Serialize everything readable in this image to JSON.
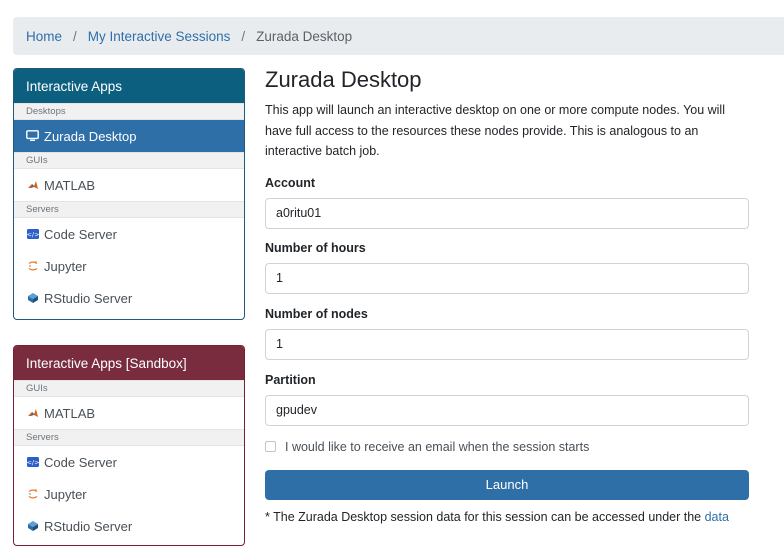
{
  "breadcrumb": {
    "home": "Home",
    "sessions": "My Interactive Sessions",
    "current": "Zurada Desktop",
    "separator": "/"
  },
  "sidebar_main": {
    "title": "Interactive Apps",
    "groups": {
      "desktops": "Desktops",
      "guis": "GUIs",
      "servers": "Servers"
    },
    "items": {
      "zurada_desktop": "Zurada Desktop",
      "matlab": "MATLAB",
      "code_server": "Code Server",
      "jupyter": "Jupyter",
      "rstudio": "RStudio Server"
    }
  },
  "sidebar_sandbox": {
    "title": "Interactive Apps [Sandbox]",
    "groups": {
      "guis": "GUIs",
      "servers": "Servers"
    },
    "items": {
      "matlab": "MATLAB",
      "code_server": "Code Server",
      "jupyter": "Jupyter",
      "rstudio": "RStudio Server"
    }
  },
  "form": {
    "title": "Zurada Desktop",
    "description": "This app will launch an interactive desktop on one or more compute nodes. You will have full access to the resources these nodes provide. This is analogous to an interactive batch job.",
    "account": {
      "label": "Account",
      "value": "a0ritu01"
    },
    "hours": {
      "label": "Number of hours",
      "value": "1"
    },
    "nodes": {
      "label": "Number of nodes",
      "value": "1"
    },
    "partition": {
      "label": "Partition",
      "value": "gpudev"
    },
    "email_checkbox": {
      "label": "I would like to receive an email when the session starts",
      "checked": false
    },
    "launch_label": "Launch",
    "footnote_text": "* The Zurada Desktop session data for this session can be accessed under the ",
    "footnote_link": "data"
  },
  "colors": {
    "primary": "#2f6fa8",
    "main_panel_header": "#0d5f80",
    "sandbox_panel_header": "#7a2c3f"
  },
  "icons": {
    "desktop": "desktop-icon",
    "matlab": "matlab-icon",
    "code_server": "code-server-icon",
    "jupyter": "jupyter-icon",
    "rstudio": "rstudio-icon"
  }
}
